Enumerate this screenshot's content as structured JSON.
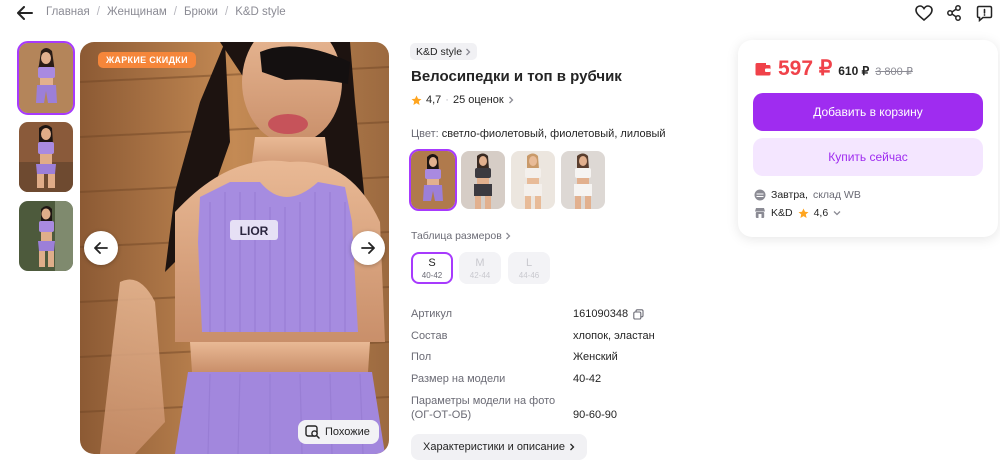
{
  "breadcrumbs": [
    "Главная",
    "Женщинам",
    "Брюки",
    "K&D style"
  ],
  "icons": {
    "back": "arrow-left-icon",
    "favorite": "heart-icon",
    "share": "share-icon",
    "report": "report-icon"
  },
  "gallery": {
    "badge": "ЖАРКИЕ СКИДКИ",
    "similar_label": "Похожие",
    "shirt_print": "LIOR",
    "thumbnail_count": 3
  },
  "product": {
    "brand": "K&D style",
    "title": "Велосипедки и топ в рубчик",
    "rating": "4,7",
    "reviews": "25 оценок",
    "color_label": "Цвет:",
    "color_value": "светло-фиолетовый, фиолетовый, лиловый",
    "size_table_label": "Таблица размеров",
    "sizes": [
      {
        "letter": "S",
        "range": "40-42",
        "available": true,
        "selected": true
      },
      {
        "letter": "M",
        "range": "42-44",
        "available": false,
        "selected": false
      },
      {
        "letter": "L",
        "range": "44-46",
        "available": false,
        "selected": false
      }
    ],
    "params": [
      {
        "label": "Артикул",
        "value": "161090348"
      },
      {
        "label": "Состав",
        "value": "хлопок, эластан"
      },
      {
        "label": "Пол",
        "value": "Женский"
      },
      {
        "label": "Размер на модели",
        "value": "40-42"
      },
      {
        "label": "Параметры модели на фото (ОГ-ОТ-ОБ)",
        "value": "90-60-90"
      }
    ],
    "details_button": "Характеристики и описание"
  },
  "price_card": {
    "price": "597 ₽",
    "price_wallet": "610 ₽",
    "old_price": "3 800 ₽",
    "add_to_cart": "Добавить в корзину",
    "buy_now": "Купить сейчас",
    "delivery_day": "Завтра,",
    "delivery_warehouse": "склад WB",
    "seller_name": "K&D",
    "seller_rating": "4,6"
  },
  "colors": {
    "accent": "#a73afd",
    "button": "#9f2cf0",
    "price": "#f0424a",
    "badge": "#f5863a",
    "star": "#ffa51f"
  }
}
